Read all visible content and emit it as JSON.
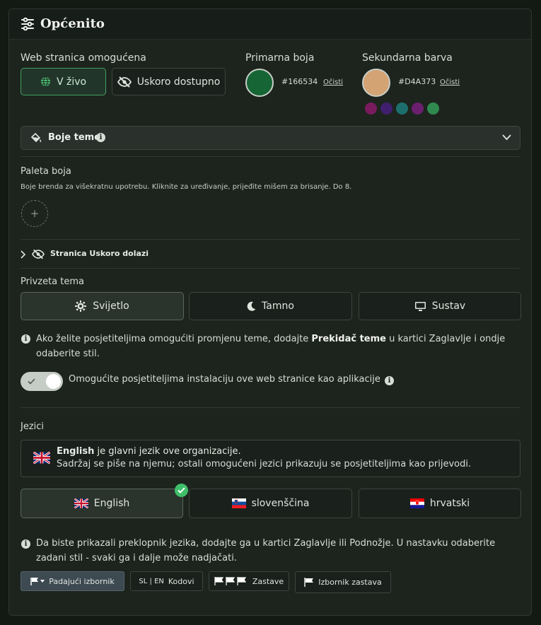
{
  "header": {
    "title": "Općenito",
    "icon": "sliders-icon"
  },
  "website": {
    "label": "Web stranica omogućena",
    "live_label": "V živo",
    "soon_label": "Uskoro dostupno"
  },
  "primary": {
    "label": "Primarna boja",
    "color": "#166534",
    "hex": "#166534",
    "clear": "Očisti"
  },
  "secondary": {
    "label": "Sekundarna barva",
    "color": "#D4A373",
    "hex": "#D4A373",
    "clear": "Očisti",
    "presets": [
      "#7a1b5e",
      "#3f1f6e",
      "#1d6f6e",
      "#6b1f6e",
      "#2f8a4f"
    ]
  },
  "theme_colors": {
    "label": "Boje teme"
  },
  "palette": {
    "label": "Paleta boja",
    "description": "Boje brenda za višekratnu upotrebu. Kliknite za uređivanje, prijeđite mišem za brisanje. Do 8.",
    "add": "+"
  },
  "coming_soon": {
    "label": "Stranica Uskoro dolazi"
  },
  "default_theme": {
    "label": "Privzeta tema",
    "options": [
      "Svijetlo",
      "Tamno",
      "Sustav"
    ],
    "selected": "Svijetlo"
  },
  "theme_info": {
    "before": "Ako želite posjetiteljima omogućiti promjenu teme, dodajte ",
    "bold": "Prekidač teme",
    "after": " u kartici Zaglavlje i ondje odaberite stil."
  },
  "pwa": {
    "label": "Omogućite posjetiteljima instalaciju ove web stranice kao aplikacije",
    "enabled": true
  },
  "languages": {
    "label": "Jezici",
    "main_bold": "English",
    "main_rest": " je glavni jezik ove organizacije.",
    "main_sub": "Sadržaj se piše na njemu; ostali omogućeni jezici prikazuju se posjetiteljima kao prijevodi.",
    "items": [
      "English",
      "slovenščina",
      "hrvatski"
    ],
    "selected": "English"
  },
  "switcher_info": {
    "text": "Da biste prikazali preklopnik jezika, dodajte ga u kartici Zaglavlje ili Podnožje. U nastavku odaberite zadani stil - svaki ga i dalje može nadjačati."
  },
  "styles": {
    "dropdown": "Padajući izbornik",
    "codes_prefix": "SL | EN",
    "codes": "Kodovi",
    "flags": "Zastave",
    "flag_menu": "Izbornik zastava"
  }
}
